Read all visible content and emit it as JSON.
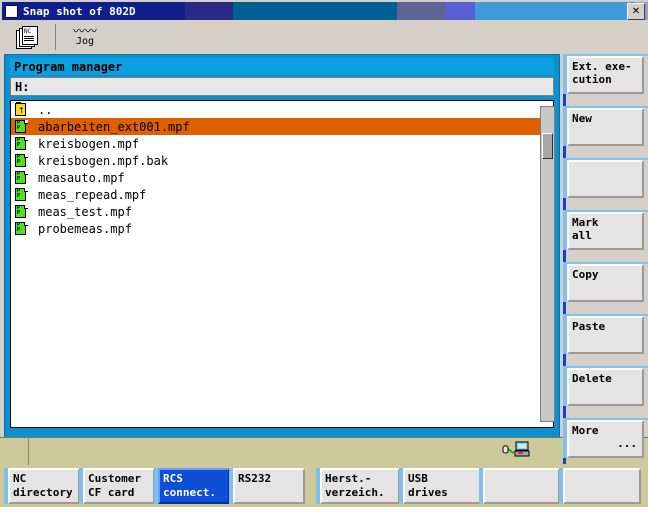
{
  "window": {
    "title": "Snap shot of 802D",
    "close_label": "✕",
    "icon": "window-icon",
    "titlebar_segments": [
      "#0e1f8c",
      "#2a2a86",
      "#4020a8",
      "#005f95",
      "#005f95",
      "#5f6496",
      "#5b5fd6",
      "#3f9bd8",
      "#3f9bd8",
      "#9b9bd4",
      "#7fd2c8",
      "#a2cdf2"
    ]
  },
  "toolbar": {
    "buttons": [
      {
        "name": "nc-button",
        "label": "NC"
      },
      {
        "name": "jog-button",
        "label": "Jog",
        "glyph": "〰〰"
      }
    ]
  },
  "panel": {
    "title": "Program manager",
    "path": "H:",
    "files": [
      {
        "name": "..",
        "type": "folder-up"
      },
      {
        "name": "abarbeiten_ext001.mpf",
        "type": "program",
        "selected": true
      },
      {
        "name": "kreisbogen.mpf",
        "type": "program",
        "selected": false
      },
      {
        "name": "kreisbogen.mpf.bak",
        "type": "program",
        "selected": false
      },
      {
        "name": "measauto.mpf",
        "type": "program",
        "selected": false
      },
      {
        "name": "meas_repead.mpf",
        "type": "program",
        "selected": false
      },
      {
        "name": "meas_test.mpf",
        "type": "program",
        "selected": false
      },
      {
        "name": "probemeas.mpf",
        "type": "program",
        "selected": false
      }
    ],
    "selection_color": "#e06000",
    "header_color": "#0d9fe0"
  },
  "sidebar": {
    "buttons": [
      {
        "name": "ext-execution-button",
        "line1": "Ext. exe-",
        "line2": "cution"
      },
      {
        "name": "new-button",
        "line1": "New",
        "line2": ""
      },
      {
        "name": "empty-button-1",
        "line1": "",
        "line2": ""
      },
      {
        "name": "mark-all-button",
        "line1": "Mark",
        "line2": "all"
      },
      {
        "name": "copy-button",
        "line1": "Copy",
        "line2": ""
      },
      {
        "name": "paste-button",
        "line1": "Paste",
        "line2": ""
      },
      {
        "name": "delete-button",
        "line1": "Delete",
        "line2": ""
      },
      {
        "name": "more-button",
        "line1": "More",
        "line2": "..."
      }
    ]
  },
  "statusbar": {
    "connection_icon": "network-connection-icon"
  },
  "tabs": [
    {
      "name": "tab-nc-directory",
      "line1": "NC",
      "line2": "directory",
      "active": false
    },
    {
      "name": "tab-customer-cf-card",
      "line1": "Customer",
      "line2": "CF card",
      "active": false
    },
    {
      "name": "tab-rcs-connect",
      "line1": "RCS",
      "line2": "connect.",
      "active": true
    },
    {
      "name": "tab-rs232",
      "line1": "RS232",
      "line2": "",
      "active": false
    },
    {
      "name": "tab-herst-verzeich",
      "line1": "Herst.-",
      "line2": "verzeich.",
      "active": false
    },
    {
      "name": "tab-usb-drives",
      "line1": "USB",
      "line2": "drives",
      "active": false
    },
    {
      "name": "tab-empty-1",
      "line1": "",
      "line2": "",
      "active": false
    },
    {
      "name": "tab-empty-2",
      "line1": "",
      "line2": "",
      "active": false
    }
  ]
}
